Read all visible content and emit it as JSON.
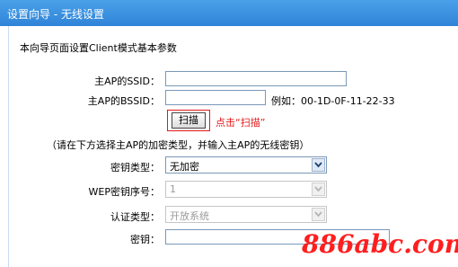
{
  "header": {
    "title": "设置向导 - 无线设置"
  },
  "intro": "本向导页面设置Client模式基本参数",
  "fields": {
    "ssid_label": "主AP的SSID：",
    "ssid_value": "",
    "bssid_label": "主AP的BSSID：",
    "bssid_value": "",
    "bssid_example": "例如：00-1D-0F-11-22-33"
  },
  "scan": {
    "button_label": "扫描",
    "hint": "点击“扫描”"
  },
  "instruction": "（请在下方选择主AP的加密类型，并输入主AP的无线密钥）",
  "security": {
    "key_type_label": "密钥类型：",
    "key_type_value": "无加密",
    "wep_index_label": "WEP密钥序号：",
    "wep_index_value": "1",
    "auth_type_label": "认证类型：",
    "auth_type_value": "开放系统",
    "key_label": "密钥：",
    "key_value": ""
  },
  "watermark": "886abc.com",
  "colors": {
    "header": "#2f84d8",
    "hint_red": "#e21818",
    "watermark": "#ff1e1e"
  }
}
